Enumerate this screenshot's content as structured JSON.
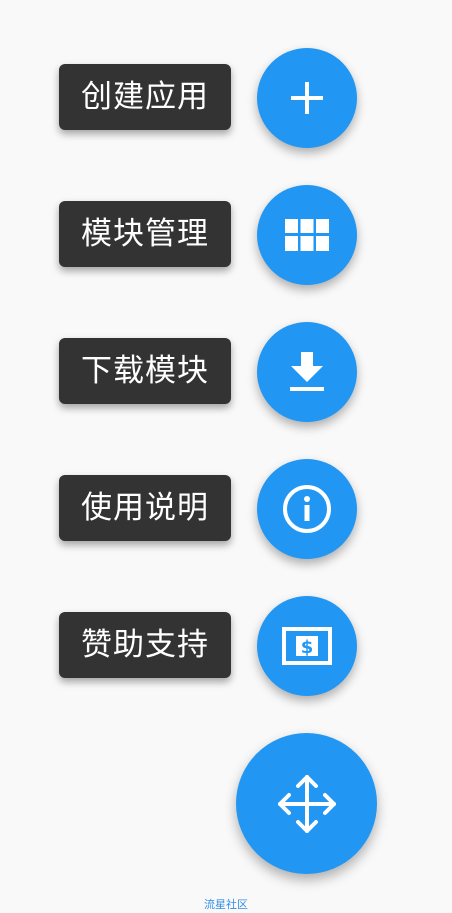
{
  "menu": {
    "items": [
      {
        "label": "创建应用",
        "icon": "plus-icon"
      },
      {
        "label": "模块管理",
        "icon": "grid-icon"
      },
      {
        "label": "下载模块",
        "icon": "download-icon"
      },
      {
        "label": "使用说明",
        "icon": "info-icon"
      },
      {
        "label": "赞助支持",
        "icon": "dollar-bill-icon"
      }
    ]
  },
  "main_fab": {
    "icon": "move-arrows-icon"
  },
  "watermark": {
    "text": "流星社区"
  },
  "colors": {
    "accent": "#2196f3",
    "label_bg": "#333333",
    "background": "#f9f9f9"
  }
}
